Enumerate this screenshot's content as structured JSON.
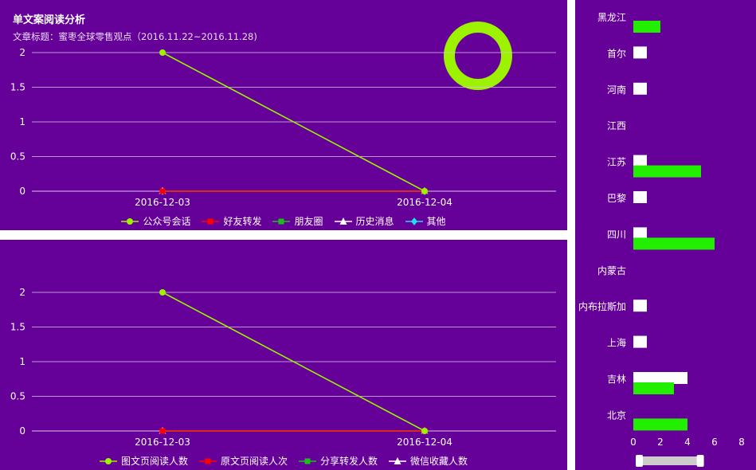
{
  "top_panel": {
    "title": "单文案阅读分析",
    "subtitle": "文章标题：蜜枣全球零售观点（2016.11.22~2016.11.28)",
    "legend": [
      {
        "label": "公众号会话",
        "color": "#9cf200",
        "marker": "circle"
      },
      {
        "label": "好友转发",
        "color": "#ff0000",
        "marker": "rect"
      },
      {
        "label": "朋友圈",
        "color": "#1bbf1b",
        "marker": "rect"
      },
      {
        "label": "历史消息",
        "color": "#ffffff",
        "marker": "triangle"
      },
      {
        "label": "其他",
        "color": "#22ddee",
        "marker": "diamond"
      }
    ]
  },
  "bottom_panel": {
    "legend": [
      {
        "label": "图文页阅读人数",
        "color": "#9cf200",
        "marker": "circle"
      },
      {
        "label": "原文页阅读人次",
        "color": "#ff0000",
        "marker": "rect"
      },
      {
        "label": "分享转发人数",
        "color": "#1bbf1b",
        "marker": "rect"
      },
      {
        "label": "微信收藏人数",
        "color": "#ffffff",
        "marker": "triangle"
      }
    ]
  },
  "chart_data": [
    {
      "type": "line",
      "title": "单文案阅读分析",
      "subtitle": "文章标题：蜜枣全球零售观点（2016.11.22~2016.11.28)",
      "categories": [
        "2016-12-03",
        "2016-12-04"
      ],
      "yticks": [
        "0",
        "0.5",
        "1",
        "1.5",
        "2"
      ],
      "ylim": [
        0,
        2
      ],
      "series": [
        {
          "name": "公众号会话",
          "values": [
            2,
            0
          ],
          "color": "#9cf200",
          "marker": "circle"
        },
        {
          "name": "好友转发",
          "values": [
            0,
            0
          ],
          "color": "#ff0000",
          "marker": "rect"
        },
        {
          "name": "朋友圈",
          "values": [
            0,
            0
          ],
          "color": "#1bbf1b",
          "marker": "rect"
        },
        {
          "name": "历史消息",
          "values": [
            0,
            0
          ],
          "color": "#ffffff",
          "marker": "triangle"
        },
        {
          "name": "其他",
          "values": [
            0,
            0
          ],
          "color": "#22ddee",
          "marker": "diamond"
        }
      ],
      "grid": true,
      "legend_position": "bottom"
    },
    {
      "type": "line",
      "categories": [
        "2016-12-03",
        "2016-12-04"
      ],
      "yticks": [
        "0",
        "0.5",
        "1",
        "1.5",
        "2"
      ],
      "ylim": [
        0,
        2
      ],
      "series": [
        {
          "name": "图文页阅读人数",
          "values": [
            2,
            0
          ],
          "color": "#9cf200",
          "marker": "circle"
        },
        {
          "name": "原文页阅读人次",
          "values": [
            0,
            0
          ],
          "color": "#ff0000",
          "marker": "rect"
        },
        {
          "name": "分享转发人数",
          "values": [
            0,
            0
          ],
          "color": "#1bbf1b",
          "marker": "rect"
        },
        {
          "name": "微信收藏人数",
          "values": [
            0,
            0
          ],
          "color": "#ffffff",
          "marker": "triangle"
        }
      ],
      "grid": true,
      "legend_position": "bottom"
    },
    {
      "type": "bar",
      "orientation": "horizontal",
      "categories": [
        "黑龙江",
        "首尔",
        "河南",
        "江西",
        "江苏",
        "巴黎",
        "四川",
        "内蒙古",
        "内布拉斯加",
        "上海",
        "吉林",
        "北京"
      ],
      "series": [
        {
          "color": "#ffffff",
          "values": [
            0,
            1,
            1,
            0,
            1,
            1,
            1,
            0,
            1,
            1,
            4,
            0
          ]
        },
        {
          "color": "#22ee00",
          "values": [
            2,
            0,
            0,
            0,
            5,
            0,
            6,
            0,
            0,
            0,
            3,
            4
          ]
        }
      ],
      "xticks": [
        "0",
        "2",
        "4",
        "6",
        "8"
      ],
      "xlim": [
        0,
        8
      ],
      "zoom_range": [
        0,
        0.6
      ]
    }
  ]
}
